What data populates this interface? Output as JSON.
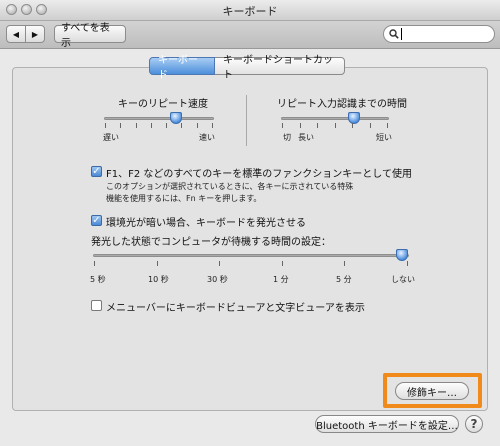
{
  "window": {
    "title": "キーボード"
  },
  "toolbar": {
    "show_all_label": "すべてを表示",
    "back_icon": "◀",
    "forward_icon": "▶",
    "search_placeholder": ""
  },
  "tabs": [
    {
      "label": "キーボード",
      "selected": true
    },
    {
      "label": "キーボードショートカット",
      "selected": false
    }
  ],
  "key_repeat": {
    "title": "キーのリピート速度",
    "left_label": "遅い",
    "right_label": "速い",
    "value_fraction": 0.7
  },
  "repeat_delay": {
    "title": "リピート入力認識までの時間",
    "labels": [
      "切",
      "長い",
      "短い"
    ],
    "value_fraction": 0.58
  },
  "fn_keys": {
    "label": "F1、F2 などのすべてのキーを標準のファンクションキーとして使用",
    "checked": true,
    "note_line1": "このオプションが選択されているときに、各キーに示されている特殊",
    "note_line2": "機能を使用するには、Fn キーを押します。"
  },
  "illumination": {
    "label": "環境光が暗い場合、キーボードを発光させる",
    "checked": true
  },
  "idle": {
    "title": "発光した状態でコンピュータが待機する時間の設定：",
    "tick_labels": [
      "5 秒",
      "10 秒",
      "30 秒",
      "1 分",
      "5 分",
      "しない"
    ],
    "value_fraction": 1.0
  },
  "menubar_viewer": {
    "label": "メニューバーにキーボードビューアと文字ビューアを表示",
    "checked": false
  },
  "buttons": {
    "modifier_keys": "修飾キー…",
    "bluetooth": "Bluetooth キーボードを設定…",
    "help": "?"
  },
  "colors": {
    "highlight": "#f08a1a",
    "accent": "#4d8fdb"
  }
}
